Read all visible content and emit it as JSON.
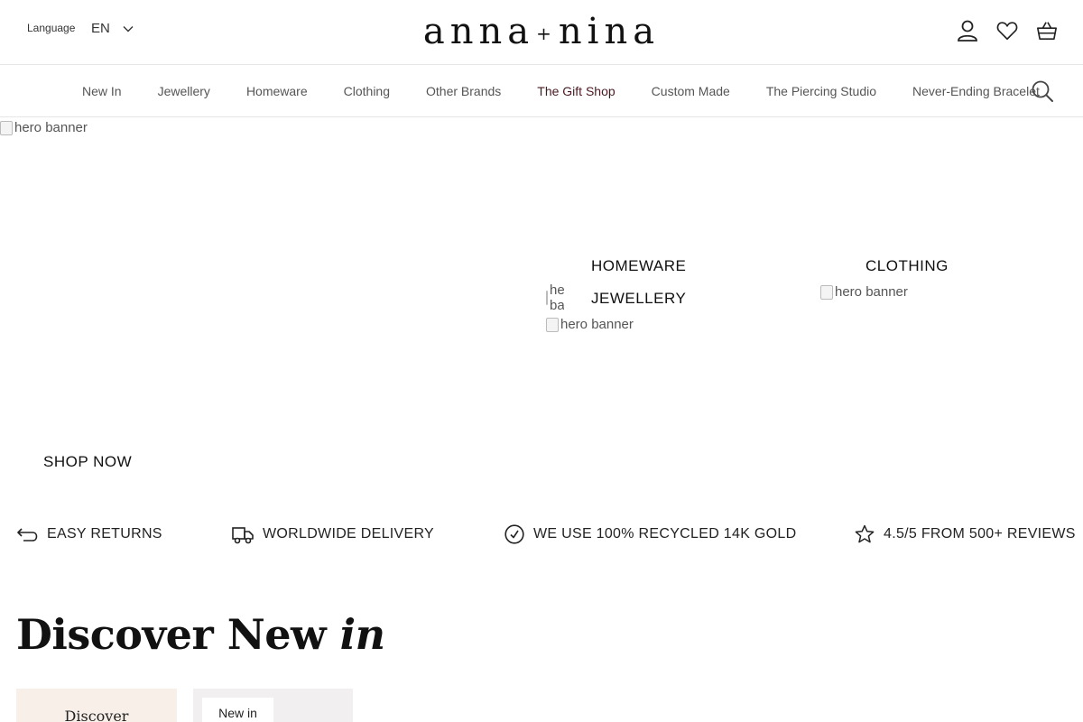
{
  "header": {
    "language_label": "Language",
    "language_value": "EN",
    "logo_left": "anna",
    "logo_plus": "+",
    "logo_right": "nina",
    "icons": [
      "account-icon",
      "heart-icon",
      "basket-icon"
    ]
  },
  "nav": {
    "items": [
      {
        "label": "New In"
      },
      {
        "label": "Jewellery"
      },
      {
        "label": "Homeware"
      },
      {
        "label": "Clothing"
      },
      {
        "label": "Other Brands"
      },
      {
        "label": "The Gift Shop",
        "active": true
      },
      {
        "label": "Custom Made"
      },
      {
        "label": "The Piercing Studio"
      },
      {
        "label": "Never-Ending Bracelet"
      }
    ],
    "active_color": "#4a1a22"
  },
  "hero": {
    "main_image_alt": "hero banner",
    "homeware_label": "HOMEWARE",
    "homeware_image_alt": "hero banner",
    "clothing_label": "CLOTHING",
    "clothing_image_alt": "hero banner",
    "jewellery_label": "JEWELLERY",
    "jewellery_image_alt": "hero banner",
    "shop_now": "SHOP NOW"
  },
  "usps": [
    {
      "icon": "return-arrow-icon",
      "text": "EASY RETURNS"
    },
    {
      "icon": "delivery-truck-icon",
      "text": "WORLDWIDE DELIVERY"
    },
    {
      "icon": "check-circle-icon",
      "text": "WE USE 100% RECYCLED 14K GOLD"
    },
    {
      "icon": "star-icon",
      "text": "4.5/5 FROM 500+ REVIEWS"
    }
  ],
  "discover": {
    "title_main": "Discover New ",
    "title_italic": "in",
    "card1_label": "Discover",
    "card2_tag": "New in"
  },
  "colors": {
    "card1_bg": "#f8efe9",
    "card2_bg": "#f1efef",
    "border": "#e6e6e6"
  }
}
